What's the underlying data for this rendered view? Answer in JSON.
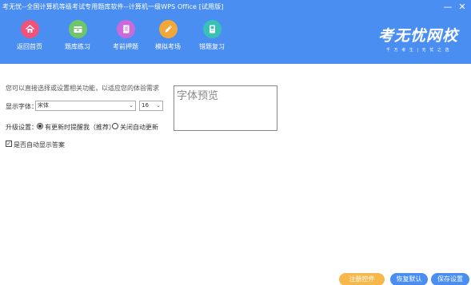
{
  "window": {
    "title": "考无忧--全国计算机等级考试专用题库软件--计算机一级WPS Office [试用版]",
    "minimize_glyph": "—",
    "close_glyph": "✕"
  },
  "toolbar": {
    "items": [
      {
        "label": "返回首页",
        "icon": "home-icon",
        "color": "#f0527a"
      },
      {
        "label": "题库练习",
        "icon": "folder-icon",
        "color": "#6dc66a"
      },
      {
        "label": "考前押题",
        "icon": "notebook-icon",
        "color": "#c96bdc"
      },
      {
        "label": "模拟考场",
        "icon": "pencil-icon",
        "color": "#f0a83a"
      },
      {
        "label": "错题复习",
        "icon": "book-icon",
        "color": "#39c1b8"
      }
    ]
  },
  "brand": {
    "logo": "考无忧网校",
    "slogan": "千 万 考 生 | 无 忧 之 选"
  },
  "settings": {
    "hint": "您可以直接选择或设置相关功能，以适应您的体验需求",
    "font_label": "显示字体：",
    "font_value": "宋体",
    "size_value": "16",
    "upgrade_label": "升级设置：",
    "radio_notify": "有更新时提醒我（推荐）",
    "radio_auto": "关闭自动更新",
    "auto_answer": "是否自动显示答案",
    "preview_text": "字体预览"
  },
  "buttons": {
    "register": "注册控件",
    "restore": "恢复默认",
    "save": "保存设置"
  },
  "colors": {
    "header": "#4a8ef1",
    "register_btn": "#f6b84a",
    "action_btn": "#4a8ef1"
  }
}
